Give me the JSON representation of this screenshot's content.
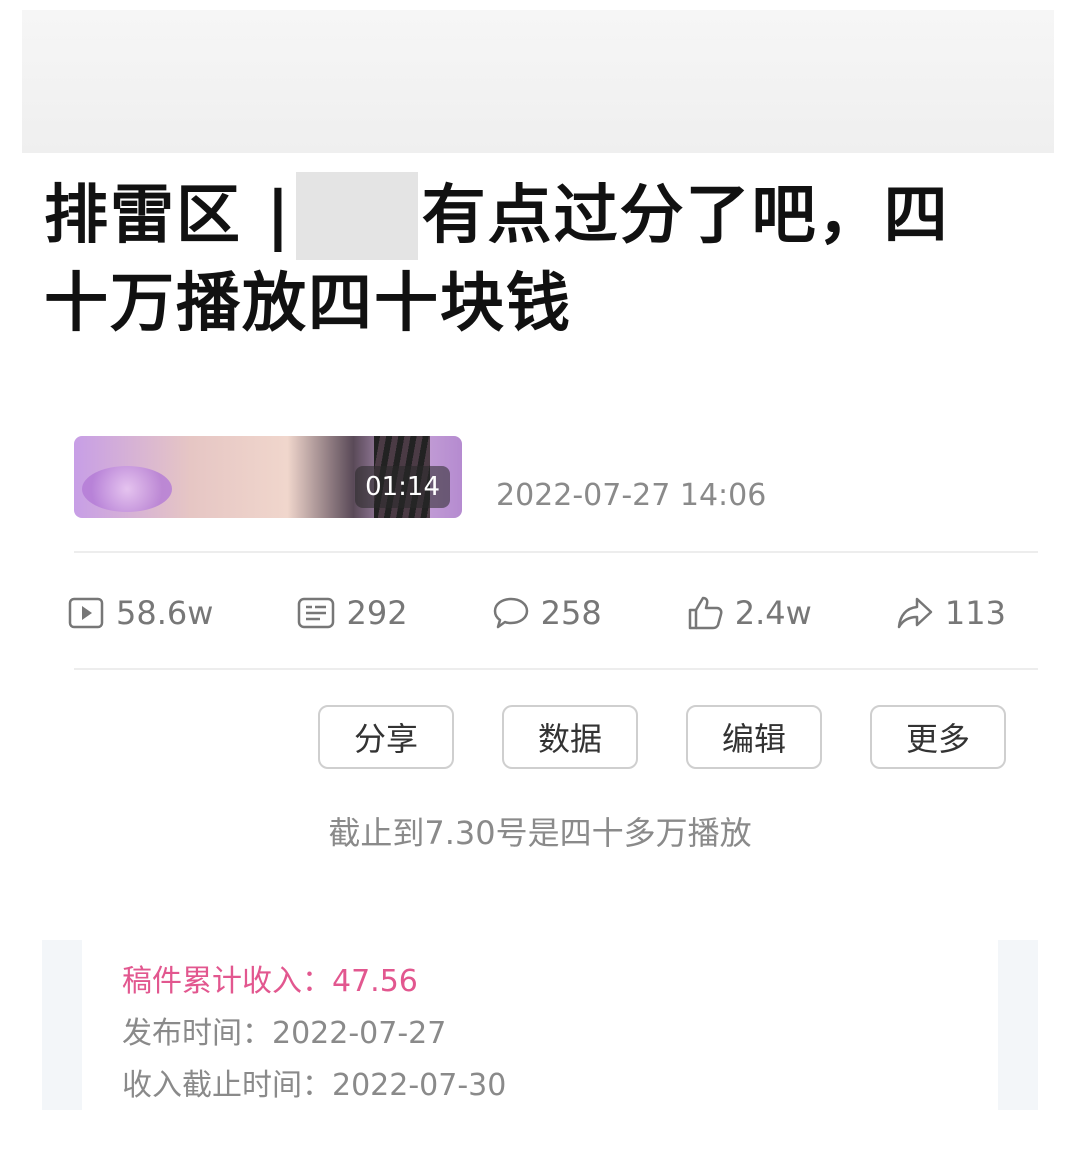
{
  "title": {
    "prefix": "排雷区 |",
    "suffix_line1": "有点过分了吧，四",
    "line2": "十万播放四十块钱"
  },
  "video": {
    "duration": "01:14",
    "published": "2022-07-27 14:06"
  },
  "stats": {
    "plays": "58.6w",
    "danmaku": "292",
    "comments": "258",
    "likes": "2.4w",
    "shares": "113"
  },
  "actions": {
    "share": "分享",
    "data": "数据",
    "edit": "编辑",
    "more": "更多"
  },
  "note": "截止到7.30号是四十多万播放",
  "income": {
    "total": "稿件累计收入：47.56",
    "publish_time": "发布时间：2022-07-27",
    "cutoff_time": "收入截止时间：2022-07-30"
  },
  "colors": {
    "income_accent": "#e2578f",
    "muted_text": "#8a8a8a"
  }
}
